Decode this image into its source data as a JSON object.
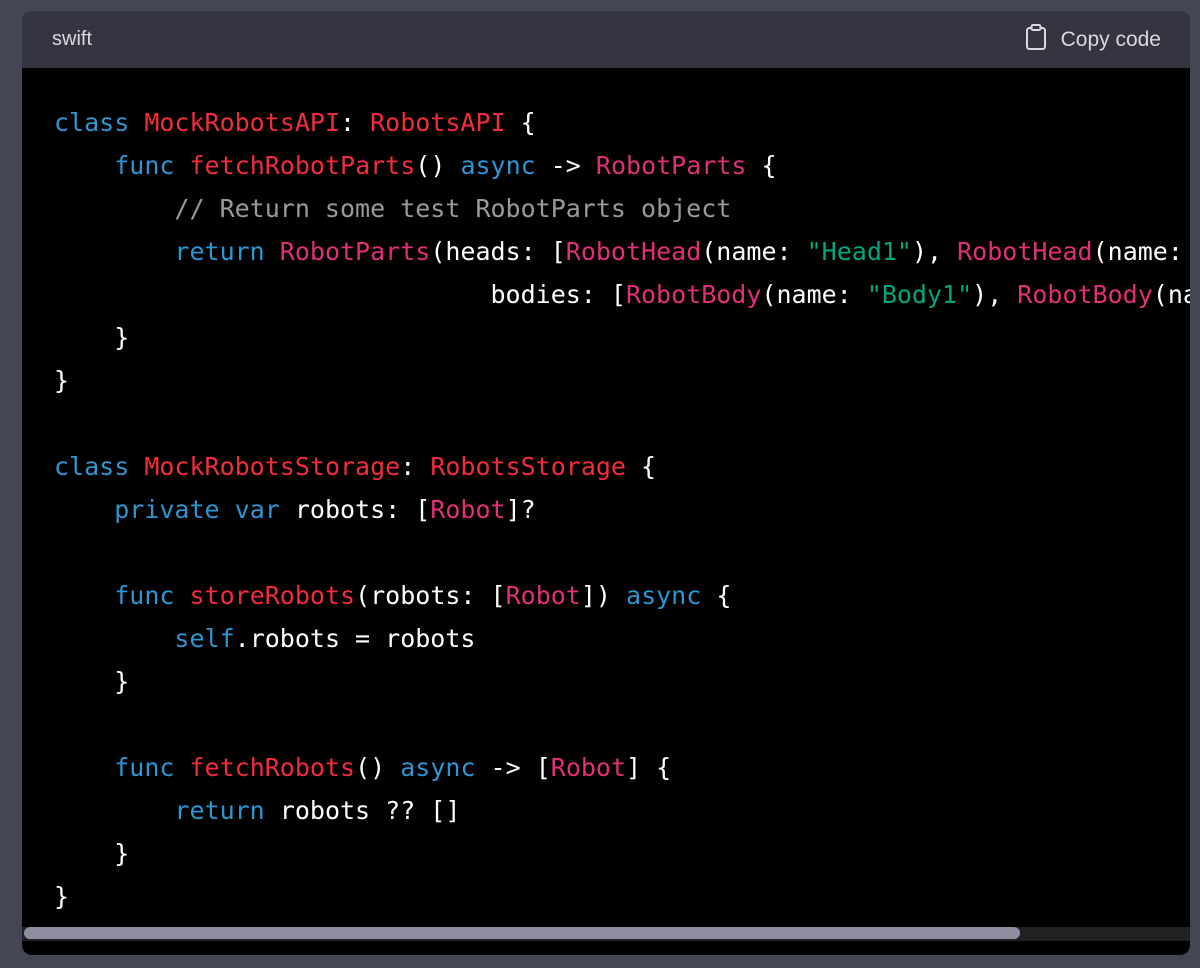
{
  "header": {
    "language": "swift",
    "copy_label": "Copy code",
    "copy_icon": "clipboard-icon"
  },
  "colors": {
    "page_background": "#444654",
    "header_background": "#343541",
    "code_background": "#000000",
    "keyword": "#2e95d3",
    "type": "#df3079",
    "function": "#f22c3d",
    "string": "#00a67d",
    "comment": "#ffffff99",
    "plain": "#ffffff"
  },
  "code": {
    "lines": [
      [
        {
          "t": "class",
          "c": "kw"
        },
        {
          "t": " "
        },
        {
          "t": "MockRobotsAPI",
          "c": "fn"
        },
        {
          "t": ": "
        },
        {
          "t": "RobotsAPI",
          "c": "fn"
        },
        {
          "t": " {"
        }
      ],
      [
        {
          "t": "    "
        },
        {
          "t": "func",
          "c": "kw"
        },
        {
          "t": " "
        },
        {
          "t": "fetchRobotParts",
          "c": "fn"
        },
        {
          "t": "() "
        },
        {
          "t": "async",
          "c": "kw"
        },
        {
          "t": " -> "
        },
        {
          "t": "RobotParts",
          "c": "ty"
        },
        {
          "t": " {"
        }
      ],
      [
        {
          "t": "        "
        },
        {
          "t": "// Return some test RobotParts object",
          "c": "cm"
        }
      ],
      [
        {
          "t": "        "
        },
        {
          "t": "return",
          "c": "kw"
        },
        {
          "t": " "
        },
        {
          "t": "RobotParts",
          "c": "ty"
        },
        {
          "t": "(heads: ["
        },
        {
          "t": "RobotHead",
          "c": "ty"
        },
        {
          "t": "(name: "
        },
        {
          "t": "\"Head1\"",
          "c": "str"
        },
        {
          "t": "), "
        },
        {
          "t": "RobotHead",
          "c": "ty"
        },
        {
          "t": "(name: "
        }
      ],
      [
        {
          "t": "                             bodies: ["
        },
        {
          "t": "RobotBody",
          "c": "ty"
        },
        {
          "t": "(name: "
        },
        {
          "t": "\"Body1\"",
          "c": "str"
        },
        {
          "t": "), "
        },
        {
          "t": "RobotBody",
          "c": "ty"
        },
        {
          "t": "(name: "
        }
      ],
      [
        {
          "t": "    }"
        }
      ],
      [
        {
          "t": "}"
        }
      ],
      [
        {
          "t": ""
        }
      ],
      [
        {
          "t": "class",
          "c": "kw"
        },
        {
          "t": " "
        },
        {
          "t": "MockRobotsStorage",
          "c": "fn"
        },
        {
          "t": ": "
        },
        {
          "t": "RobotsStorage",
          "c": "fn"
        },
        {
          "t": " {"
        }
      ],
      [
        {
          "t": "    "
        },
        {
          "t": "private",
          "c": "kw"
        },
        {
          "t": " "
        },
        {
          "t": "var",
          "c": "kw"
        },
        {
          "t": " robots: ["
        },
        {
          "t": "Robot",
          "c": "ty"
        },
        {
          "t": "]?"
        }
      ],
      [
        {
          "t": ""
        }
      ],
      [
        {
          "t": "    "
        },
        {
          "t": "func",
          "c": "kw"
        },
        {
          "t": " "
        },
        {
          "t": "storeRobots",
          "c": "fn"
        },
        {
          "t": "(robots: ["
        },
        {
          "t": "Robot",
          "c": "ty"
        },
        {
          "t": "]) "
        },
        {
          "t": "async",
          "c": "kw"
        },
        {
          "t": " {"
        }
      ],
      [
        {
          "t": "        "
        },
        {
          "t": "self",
          "c": "kw"
        },
        {
          "t": ".robots = robots"
        }
      ],
      [
        {
          "t": "    }"
        }
      ],
      [
        {
          "t": ""
        }
      ],
      [
        {
          "t": "    "
        },
        {
          "t": "func",
          "c": "kw"
        },
        {
          "t": " "
        },
        {
          "t": "fetchRobots",
          "c": "fn"
        },
        {
          "t": "() "
        },
        {
          "t": "async",
          "c": "kw"
        },
        {
          "t": " -> ["
        },
        {
          "t": "Robot",
          "c": "ty"
        },
        {
          "t": "] {"
        }
      ],
      [
        {
          "t": "        "
        },
        {
          "t": "return",
          "c": "kw"
        },
        {
          "t": " robots ?? []"
        }
      ],
      [
        {
          "t": "    }"
        }
      ],
      [
        {
          "t": "}"
        }
      ]
    ]
  },
  "scroll": {
    "horizontal_position": 0
  }
}
